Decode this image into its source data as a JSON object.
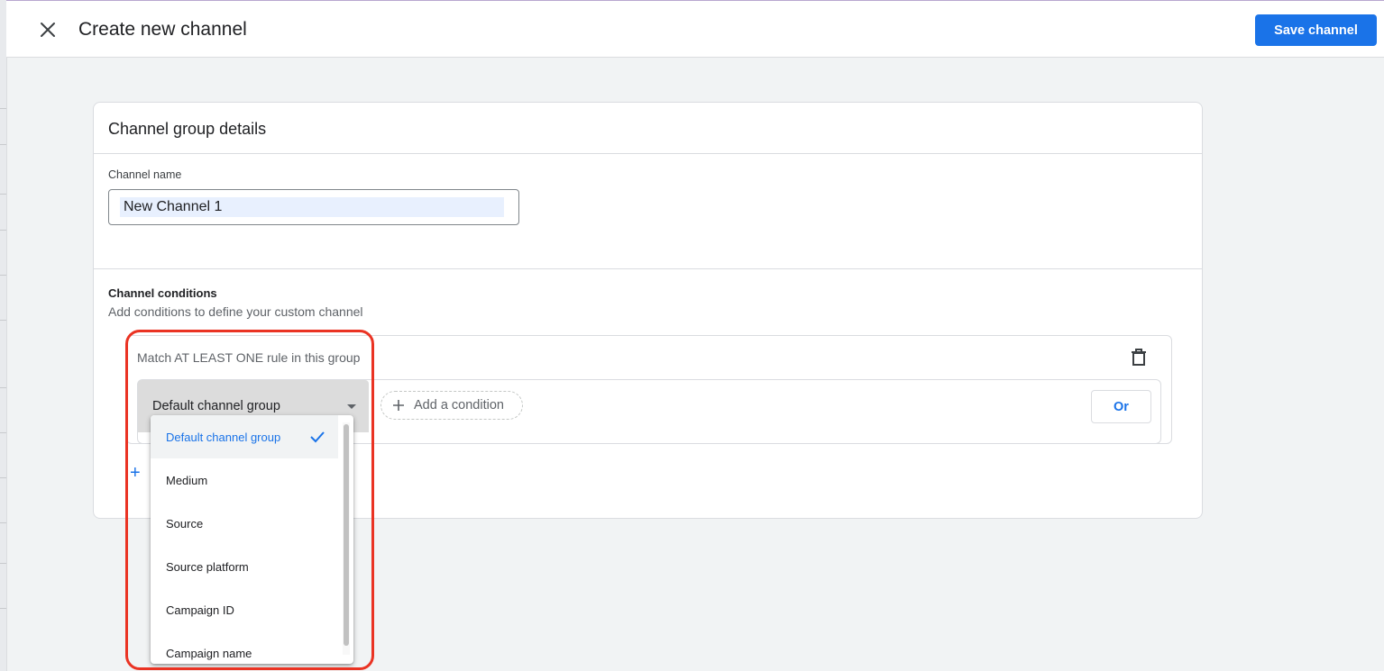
{
  "header": {
    "title": "Create new channel",
    "save_label": "Save channel"
  },
  "details": {
    "card_title": "Channel group details",
    "name_label": "Channel name",
    "name_value": "New Channel 1"
  },
  "conditions": {
    "title": "Channel conditions",
    "subtitle": "Add conditions to define your custom channel",
    "group": {
      "match_text": "Match AT LEAST ONE rule in this group",
      "selected_dimension": "Default channel group",
      "add_condition_label": "Add a condition",
      "or_label": "Or"
    },
    "add_group_glyph": "+"
  },
  "dropdown": {
    "options": [
      "Default channel group",
      "Medium",
      "Source",
      "Source platform",
      "Campaign ID",
      "Campaign name"
    ],
    "selected_index": 0
  },
  "colors": {
    "primary": "#1a73e8",
    "highlight_outline": "#ea3323"
  },
  "icons": {
    "close": "close-icon",
    "trash": "trash-icon",
    "check": "check-icon",
    "plus": "plus-icon",
    "dropdown_arrow": "caret-down-icon"
  }
}
